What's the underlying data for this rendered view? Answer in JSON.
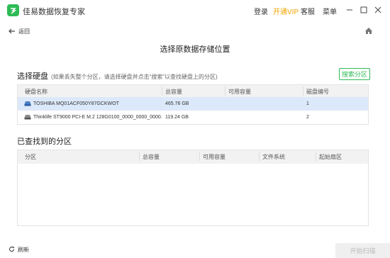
{
  "app": {
    "title": "佳易数据恢复专家"
  },
  "titlebar": {
    "login": "登录",
    "vip": "开通VIP",
    "service": "客服",
    "menu": "菜单"
  },
  "nav": {
    "back": "返回"
  },
  "page": {
    "title": "选择原数据存储位置"
  },
  "disks_section": {
    "title": "选择硬盘",
    "hint": "(如果丢失整个分区，请选择硬盘并点击“搜索”以查找硬盘上的分区)",
    "search_button": "搜索分区",
    "columns": [
      "硬盘名称",
      "总容量",
      "可用容量",
      "磁盘编号"
    ],
    "rows": [
      {
        "name": "TOSHIBA MQ01ACF050Y87GCKWOT",
        "total": "465.76 GB",
        "free": "",
        "number": "1"
      },
      {
        "name": "Thinklife ST9000 PCI-E M.2 128G0100_0000_0000_0000.",
        "total": "119.24 GB",
        "free": "",
        "number": "2"
      }
    ]
  },
  "partitions_section": {
    "title": "已查找到的分区",
    "columns": [
      "分区",
      "总容量",
      "可用容量",
      "文件系统",
      "起始扇区"
    ]
  },
  "bottom": {
    "refresh": "刷新",
    "start": "开始扫描"
  },
  "colors": {
    "brand": "#2dbb55",
    "vip": "#f0a500",
    "selected_row": "#dce9fa"
  }
}
